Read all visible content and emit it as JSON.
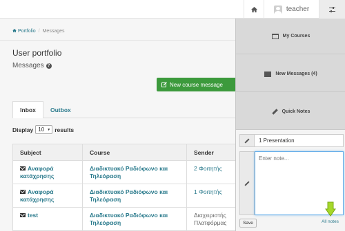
{
  "topbar": {
    "home_icon": "home-icon",
    "user_name": "teacher",
    "settings_icon": "sliders-icon"
  },
  "breadcrumb": {
    "home": "Portfolio",
    "separator": "/",
    "current": "Messages"
  },
  "page": {
    "title": "User portfolio",
    "subtitle": "Messages"
  },
  "actions": {
    "new_message": "New course message"
  },
  "tabs": [
    {
      "label": "Inbox",
      "active": true
    },
    {
      "label": "Outbox",
      "active": false
    }
  ],
  "display": {
    "prefix": "Display",
    "value": "10",
    "suffix": "results"
  },
  "table": {
    "headers": [
      "Subject",
      "Course",
      "Sender"
    ],
    "rows": [
      {
        "subject": "Αναφορά κατάχρησης",
        "course": "Διαδικτυακό Ραδιόφωνο και Τηλεόραση",
        "sender": "2 Φοιτητής"
      },
      {
        "subject": "Αναφορά κατάχρησης",
        "course": "Διαδικτυακό Ραδιόφωνο και Τηλεόραση",
        "sender": "1 Φοιτητής"
      },
      {
        "subject": "test",
        "course": "Διαδικτυακό Ραδιόφωνο και Τηλεόραση",
        "sender": "Διαχειριστής Πλατφόρμας"
      }
    ]
  },
  "panel": {
    "my_courses": "My Courses",
    "new_messages": "New Messages (4)",
    "quick_notes": "Quick Notes",
    "note_title": "1 Presentation",
    "note_placeholder": "Enter note...",
    "save": "Save",
    "all_notes": "All notes"
  },
  "colors": {
    "accent": "#2a7a8c",
    "button_green": "#3c9a3c",
    "arrow_green": "#8bc400"
  }
}
